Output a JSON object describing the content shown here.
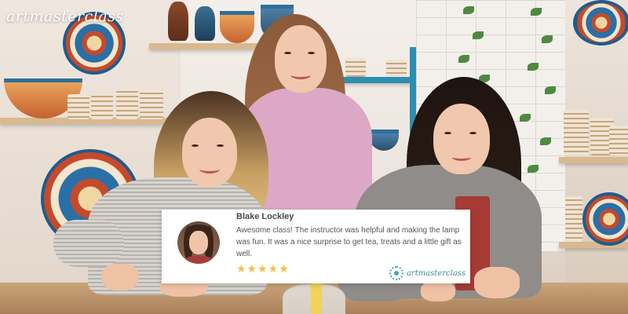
{
  "brand": {
    "logo_text": "artmasterclass"
  },
  "review": {
    "reviewer_name": "Blake Lockley",
    "text": "Awesome class! The instructor was helpful and making the lamp was fun. It was a nice surprise to get tea, treats and a little gift as well.",
    "rating": 5,
    "stars_display": "★★★★★",
    "card_logo_text": "artmasterclass"
  },
  "colors": {
    "star": "#f3c24a",
    "logo_accent": "#3f8a9a",
    "card_background": "#ffffff"
  }
}
